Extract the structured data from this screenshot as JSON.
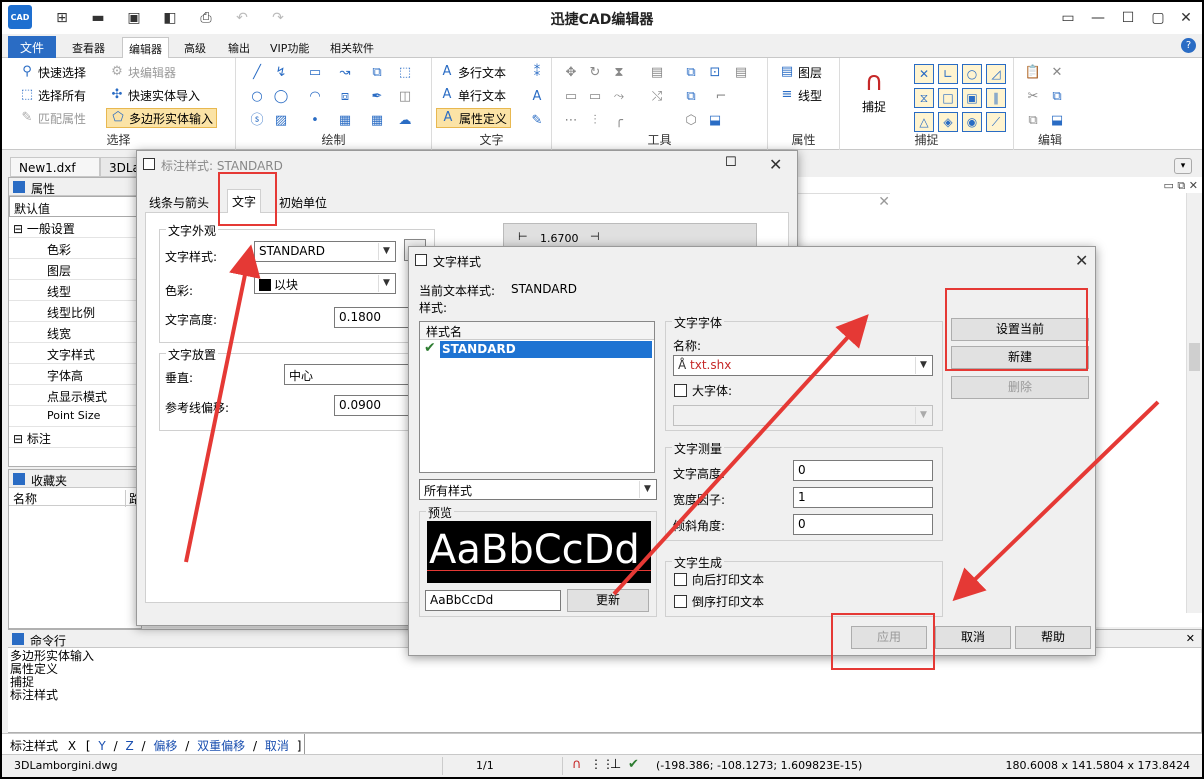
{
  "app": {
    "title": "迅捷CAD编辑器",
    "logo_text": "CAD"
  },
  "ribbon_tabs": [
    "文件",
    "查看器",
    "编辑器",
    "高级",
    "输出",
    "VIP功能",
    "相关软件"
  ],
  "ribbon": {
    "select": {
      "label": "选择",
      "items": [
        "快速选择",
        "选择所有",
        "匹配属性",
        "块编辑器",
        "快速实体导入",
        "多边形实体输入"
      ]
    },
    "draw": {
      "label": "绘制"
    },
    "text": {
      "label": "文字",
      "items": [
        "多行文本",
        "单行文本",
        "属性定义"
      ]
    },
    "tools": {
      "label": "工具"
    },
    "props": {
      "label": "属性",
      "items": [
        "图层",
        "线型"
      ]
    },
    "snap": {
      "label": "捕捉",
      "big_label": "捕捉"
    },
    "edit": {
      "label": "编辑"
    }
  },
  "doc_tabs": [
    "New1.dxf",
    "3DLar"
  ],
  "properties_panel": {
    "title": "属性",
    "default_value": "默认值",
    "general_section": "一般设置",
    "items": [
      "色彩",
      "图层",
      "线型",
      "线型比例",
      "线宽",
      "文字样式",
      "字体高",
      "点显示模式",
      "Point Size"
    ],
    "dim_section": "标注"
  },
  "favorites_panel": {
    "title": "收藏夹",
    "col_name": "名称",
    "col_path": "路"
  },
  "command_panel": {
    "title": "命令行",
    "history": [
      "多边形实体输入",
      "属性定义",
      "捕捉",
      "标注样式"
    ]
  },
  "command_line": {
    "prefix": "标注样式",
    "options": [
      "X",
      "[",
      "Y",
      "/",
      "Z",
      "/",
      "偏移",
      "/",
      "双重偏移",
      "/",
      "取消",
      "]"
    ]
  },
  "dim_style_dialog": {
    "title": "标注样式: STANDARD",
    "tabs": [
      "线条与箭头",
      "文字",
      "初始单位"
    ],
    "appearance_group": "文字外观",
    "text_style_label": "文字样式:",
    "text_style_value": "STANDARD",
    "color_label": "色彩:",
    "color_value": "以块",
    "height_label": "文字高度:",
    "height_value": "0.1800",
    "placement_group": "文字放置",
    "vertical_label": "垂直:",
    "vertical_value": "中心",
    "baseline_label": "参考线偏移:",
    "baseline_value": "0.0900",
    "preview_dim": "1.6700"
  },
  "text_style_dialog": {
    "title": "文字样式",
    "current_label": "当前文本样式:",
    "current_value": "STANDARD",
    "styles_label": "样式:",
    "col_style_name": "样式名",
    "styles": [
      "STANDARD"
    ],
    "filter_value": "所有样式",
    "preview_group": "预览",
    "preview_text": "AaBbCcDd",
    "preview_input": "AaBbCcDd",
    "refresh_button": "更新",
    "font_group": "文字字体",
    "font_name_label": "名称:",
    "font_name_value": "txt.shx",
    "bigfont_label": "大字体:",
    "metrics_group": "文字测量",
    "height_label": "文字高度:",
    "height_value": "0",
    "width_label": "宽度因子:",
    "width_value": "1",
    "oblique_label": "倾斜角度:",
    "oblique_value": "0",
    "generation_group": "文字生成",
    "backward_label": "向后打印文本",
    "upside_label": "倒序打印文本",
    "set_current_button": "设置当前",
    "new_button": "新建",
    "delete_button": "删除",
    "apply_button": "应用",
    "cancel_button": "取消",
    "help_button": "帮助"
  },
  "status_bar": {
    "file": "3DLamborgini.dwg",
    "page": "1/1",
    "coords": "(-198.386; -108.1273; 1.609823E-15)",
    "size": "180.6008 x 141.5804 x 173.8424"
  },
  "colors": {
    "accent": "#2a6cc4",
    "annotation": "#e53935",
    "selection": "#1e73d2"
  }
}
